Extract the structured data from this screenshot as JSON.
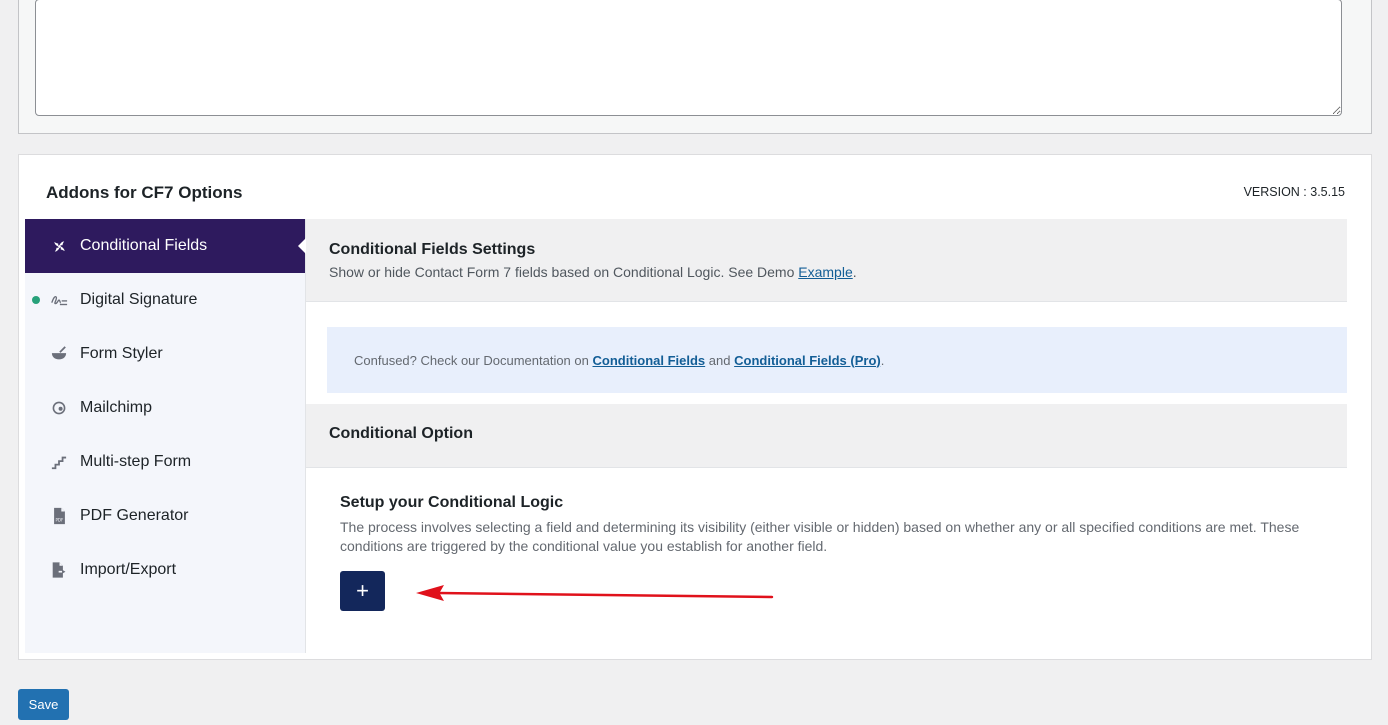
{
  "options": {
    "title": "Addons for CF7 Options",
    "version": "VERSION : 3.5.15"
  },
  "sidebar": {
    "items": [
      {
        "label": "Conditional Fields",
        "icon": "conditional-fields-icon",
        "active": true
      },
      {
        "label": "Digital Signature",
        "icon": "signature-icon",
        "status_dot": true
      },
      {
        "label": "Form Styler",
        "icon": "mortar-icon"
      },
      {
        "label": "Mailchimp",
        "icon": "mailchimp-icon"
      },
      {
        "label": "Multi-step Form",
        "icon": "steps-icon"
      },
      {
        "label": "PDF Generator",
        "icon": "pdf-icon"
      },
      {
        "label": "Import/Export",
        "icon": "file-export-icon"
      }
    ]
  },
  "settings": {
    "title": "Conditional Fields Settings",
    "desc_prefix": "Show or hide Contact Form 7 fields based on Conditional Logic. See Demo ",
    "desc_link": "Example",
    "desc_suffix": "."
  },
  "notice": {
    "prefix": "Confused? Check our Documentation on ",
    "link1": "Conditional Fields",
    "middle": " and ",
    "link2": "Conditional Fields (Pro)",
    "suffix": "."
  },
  "option": {
    "title": "Conditional Option"
  },
  "logic": {
    "title": "Setup your Conditional Logic",
    "desc": "The process involves selecting a field and determining its visibility (either visible or hidden) based on whether any or all specified conditions are met. These conditions are triggered by the conditional value you establish for another field.",
    "add_label": "+"
  },
  "save_label": "Save",
  "colors": {
    "active_nav": "#2e1a5e",
    "add_button": "#13275b",
    "save_button": "#2271b1",
    "arrow": "#e0111b",
    "status_dot": "#27a17a"
  }
}
